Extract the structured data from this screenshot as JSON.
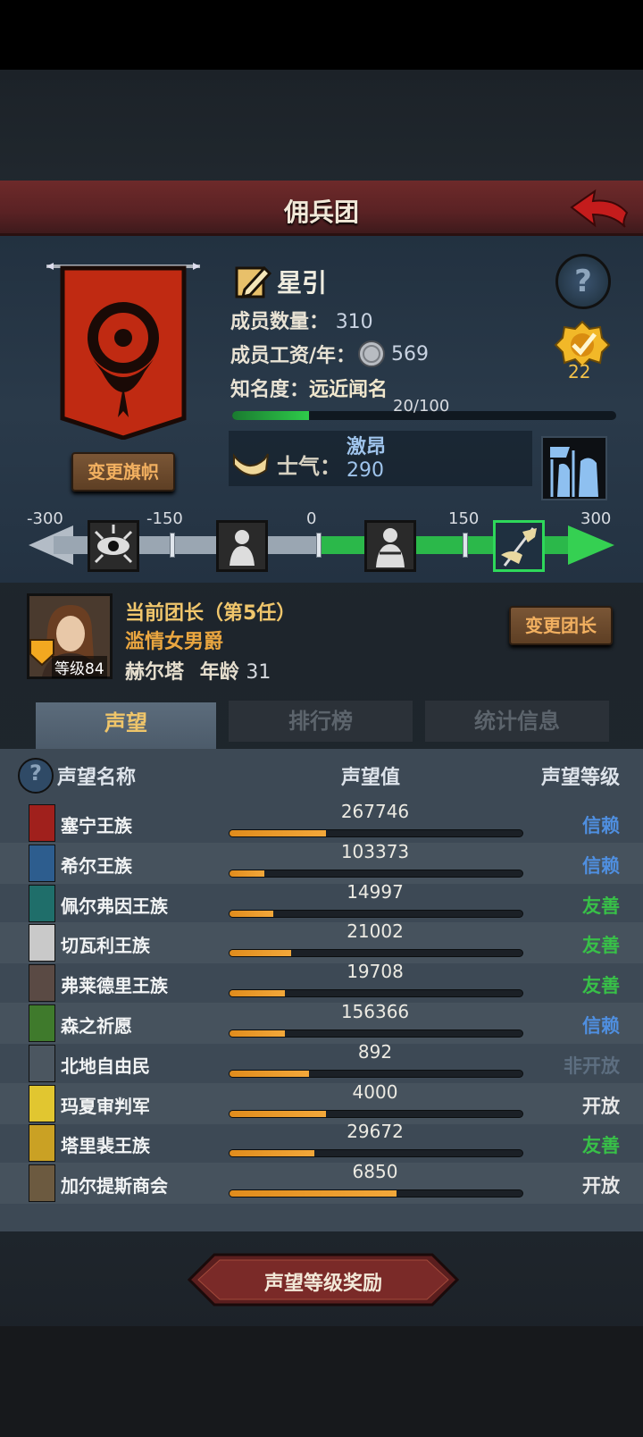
{
  "header": {
    "title": "佣兵团"
  },
  "guild": {
    "name": "星引",
    "member_count_label": "成员数量：",
    "member_count": "310",
    "salary_label": "成员工资/年：",
    "salary": "569",
    "fame_label": "知名度：",
    "fame_title": "远近闻名",
    "fame_progress": "20/100",
    "fame_fraction": 0.2,
    "medal_count": "22",
    "change_banner": "变更旗帜",
    "morale_label": "士气：",
    "morale_state": "激昂",
    "morale_value": "290",
    "help_symbol": "?"
  },
  "morale_scale": {
    "ticks": [
      "-300",
      "-150",
      "0",
      "150",
      "300"
    ],
    "icons": [
      "evil-eye-icon",
      "despair-icon",
      "calm-icon",
      "inspired-banner-icon"
    ],
    "active_index": 3
  },
  "leader": {
    "title": "当前团长（第5任）",
    "trait": "滥情女男爵",
    "name": "赫尔塔",
    "age_label": "年龄",
    "age": "31",
    "level": "等级84",
    "change_button": "变更团长"
  },
  "tabs": [
    "声望",
    "排行榜",
    "统计信息"
  ],
  "table": {
    "headers": {
      "name": "声望名称",
      "value": "声望值",
      "level": "声望等级"
    },
    "help_symbol": "?",
    "rows": [
      {
        "name": "塞宁王族",
        "value": "267746",
        "fill": 0.33,
        "level": "信赖",
        "color": "#4f8fe0",
        "icon_color": "#a0201c"
      },
      {
        "name": "希尔王族",
        "value": "103373",
        "fill": 0.12,
        "level": "信赖",
        "color": "#4f8fe0",
        "icon_color": "#2d5d8e"
      },
      {
        "name": "佩尔弗因王族",
        "value": "14997",
        "fill": 0.15,
        "level": "友善",
        "color": "#38c048",
        "icon_color": "#1f6e6a"
      },
      {
        "name": "切瓦利王族",
        "value": "21002",
        "fill": 0.21,
        "level": "友善",
        "color": "#38c048",
        "icon_color": "#c9c9c9"
      },
      {
        "name": "弗莱德里王族",
        "value": "19708",
        "fill": 0.19,
        "level": "友善",
        "color": "#38c048",
        "icon_color": "#5a4a44"
      },
      {
        "name": "森之祈愿",
        "value": "156366",
        "fill": 0.19,
        "level": "信赖",
        "color": "#4f8fe0",
        "icon_color": "#3f7a2c"
      },
      {
        "name": "北地自由民",
        "value": "892",
        "fill": 0.27,
        "level": "非开放",
        "color": "#5d6e80",
        "icon_color": "#4b5660"
      },
      {
        "name": "玛夏审判军",
        "value": "4000",
        "fill": 0.33,
        "level": "开放",
        "color": "#e8e8e8",
        "icon_color": "#e1c630"
      },
      {
        "name": "塔里裴王族",
        "value": "29672",
        "fill": 0.29,
        "level": "友善",
        "color": "#38c048",
        "icon_color": "#caa124"
      },
      {
        "name": "加尔提斯商会",
        "value": "6850",
        "fill": 0.57,
        "level": "开放",
        "color": "#e8e8e8",
        "icon_color": "#6c5a40"
      }
    ]
  },
  "reward_button": "声望等级奖励"
}
